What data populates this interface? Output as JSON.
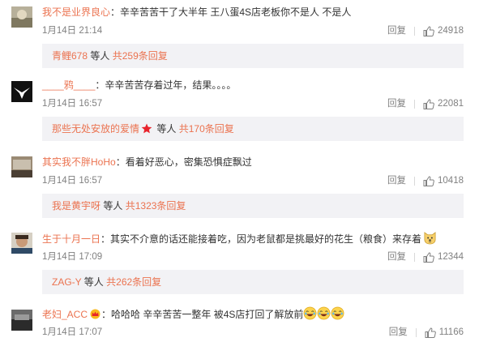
{
  "reply_label": "回复",
  "people_label": "等人",
  "comments": [
    {
      "user": "我不是业界良心",
      "text": "辛辛苦苦干了大半年 王八蛋4S店老板你不是人 不是人",
      "time": "1月14日 21:14",
      "likes": "24918",
      "sub_user": "青鲤678",
      "sub_count": "共259条回复"
    },
    {
      "user": "____鸦____",
      "text": "辛辛苦苦存着过年，结果。。。。",
      "time": "1月14日 16:57",
      "likes": "22081",
      "sub_user": "那些无处安放的爱情",
      "sub_count": "共170条回复"
    },
    {
      "user": "其实我不胖HoHo",
      "text": "看着好恶心，密集恐惧症飘过",
      "time": "1月14日 16:57",
      "likes": "10418",
      "sub_user": "我是黄宇呀",
      "sub_count": "共1323条回复"
    },
    {
      "user": "生于十月一日",
      "text": "其实不介意的话还能接着吃，因为老鼠都是挑最好的花生（粮食）来存着",
      "time": "1月14日 17:09",
      "likes": "12344",
      "sub_user": "ZAG-Y",
      "sub_count": "共262条回复"
    },
    {
      "user": "老妇_ACC",
      "text": "哈哈哈 辛辛苦苦一整年 被4S店打回了解放前",
      "time": "1月14日 17:07",
      "likes": "11166"
    }
  ],
  "colors": {
    "username": "#eb7350",
    "meta": "#808080",
    "subbox_bg": "#f2f2f5",
    "text": "#333333"
  },
  "icons": [
    "thumb-up-icon",
    "star-badge-icon",
    "crown-badge-icon",
    "dog-emoji-icon",
    "laugh-emoji-icon"
  ]
}
